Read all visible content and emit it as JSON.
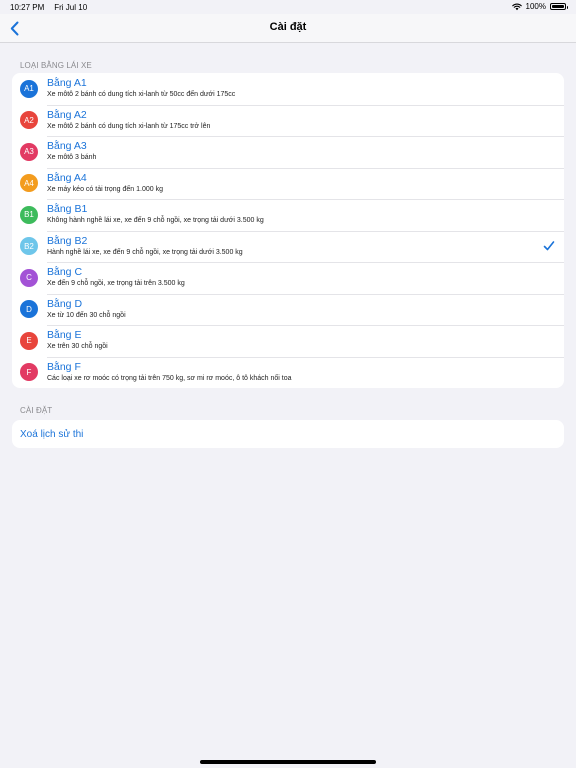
{
  "status_bar": {
    "time": "10:27 PM",
    "date": "Fri Jul 10",
    "battery": "100%",
    "battery_level": 1.0
  },
  "nav": {
    "title": "Cài đặt",
    "back_icon": "chevron-left-icon"
  },
  "colors": {
    "accent": "#1a73d9",
    "background": "#f2f2f7"
  },
  "licenses": {
    "header": "LOẠI BẰNG LÁI XE",
    "items": [
      {
        "code": "A1",
        "color": "#1a73d9",
        "title": "Bằng A1",
        "desc": "Xe môtô 2 bánh có dung tích xi-lanh từ 50cc đến dưới 175cc"
      },
      {
        "code": "A2",
        "color": "#e8453c",
        "title": "Bằng A2",
        "desc": "Xe môtô 2 bánh có dung tích xi-lanh từ 175cc trở lên"
      },
      {
        "code": "A3",
        "color": "#e23a63",
        "title": "Bằng A3",
        "desc": "Xe môtô 3 bánh"
      },
      {
        "code": "A4",
        "color": "#f39c1e",
        "title": "Bằng A4",
        "desc": "Xe máy kéo có tải trọng đến 1.000 kg"
      },
      {
        "code": "B1",
        "color": "#3dbb5c",
        "title": "Bằng B1",
        "desc": "Không hành nghề lái xe, xe đến 9 chỗ ngồi, xe trọng tải dưới 3.500 kg"
      },
      {
        "code": "B2",
        "color": "#6ec6ea",
        "title": "Bằng B2",
        "desc": "Hành nghề lái xe, xe đến 9 chỗ ngồi, xe trọng tải dưới 3.500 kg",
        "selected": true
      },
      {
        "code": "C",
        "color": "#a352d6",
        "title": "Bằng C",
        "desc": "Xe đến 9 chỗ ngồi, xe trọng tải trên 3.500 kg"
      },
      {
        "code": "D",
        "color": "#1a73d9",
        "title": "Bằng D",
        "desc": "Xe từ 10 đến 30 chỗ ngồi"
      },
      {
        "code": "E",
        "color": "#e8453c",
        "title": "Bằng E",
        "desc": "Xe trên 30 chỗ ngồi"
      },
      {
        "code": "F",
        "color": "#e23a63",
        "title": "Bằng F",
        "desc": "Các loại xe rơ moóc có trọng tải trên 750 kg, sơ mi rơ moóc, ô tô khách nối toa"
      }
    ]
  },
  "settings": {
    "header": "CÀI ĐẶT",
    "clear_history_label": "Xoá lịch sử thi"
  }
}
